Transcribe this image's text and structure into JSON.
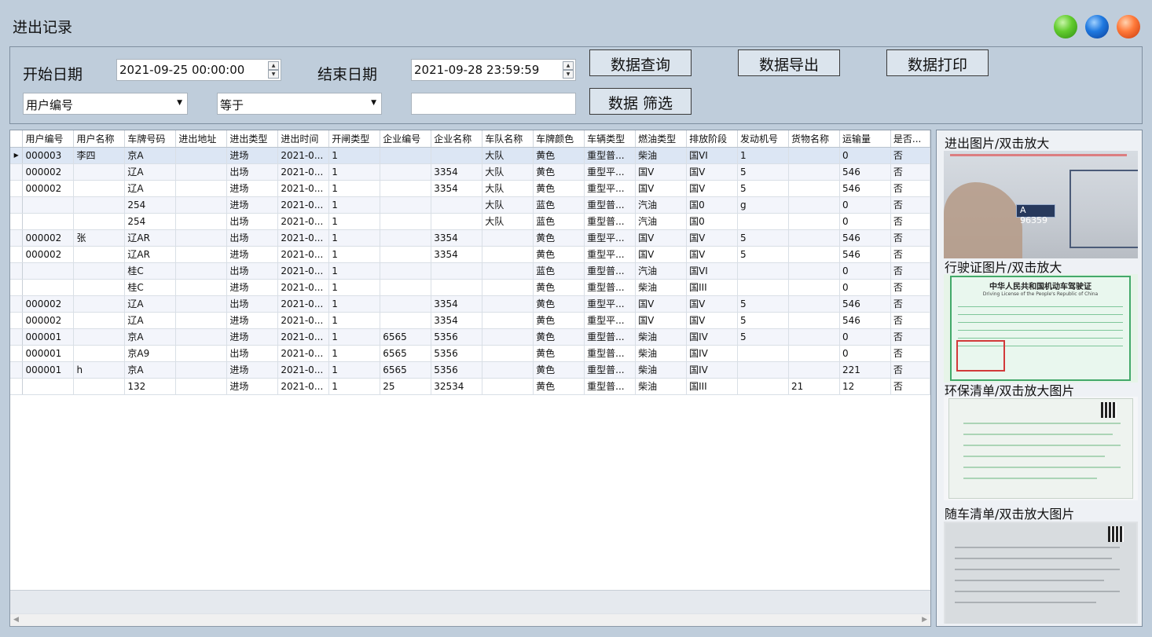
{
  "window": {
    "title": "进出记录",
    "controls": [
      "green-orb",
      "blue-orb",
      "orange-orb"
    ]
  },
  "filters": {
    "start_label": "开始日期",
    "start_value": "2021-09-25 00:00:00",
    "end_label": "结束日期",
    "end_value": "2021-09-28 23:59:59",
    "field_select": "用户编号",
    "operator_select": "等于",
    "filter_value": "",
    "buttons": {
      "query": "数据查询",
      "export": "数据导出",
      "print": "数据打印",
      "filter": "数据 筛选"
    }
  },
  "grid": {
    "columns": [
      "用户编号",
      "用户名称",
      "车牌号码",
      "进出地址",
      "进出类型",
      "进出时间",
      "开闸类型",
      "企业编号",
      "企业名称",
      "车队名称",
      "车牌颜色",
      "车辆类型",
      "燃油类型",
      "排放阶段",
      "发动机号",
      "货物名称",
      "运输量",
      "是否..."
    ],
    "rows": [
      [
        "000003",
        "李四",
        "京A",
        "",
        "进场",
        "2021-0...",
        "1",
        "",
        "",
        "大队",
        "黄色",
        "重型普...",
        "柴油",
        "国VI",
        "1",
        "",
        "0",
        "否"
      ],
      [
        "000002",
        "",
        "辽A",
        "",
        "出场",
        "2021-0...",
        "1",
        "",
        "3354",
        "大队",
        "黄色",
        "重型平...",
        "国V",
        "国V",
        "5",
        "",
        "546",
        "否"
      ],
      [
        "000002",
        "",
        "辽A",
        "",
        "进场",
        "2021-0...",
        "1",
        "",
        "3354",
        "大队",
        "黄色",
        "重型平...",
        "国V",
        "国V",
        "5",
        "",
        "546",
        "否"
      ],
      [
        "",
        "",
        "254",
        "",
        "进场",
        "2021-0...",
        "1",
        "",
        "",
        "大队",
        "蓝色",
        "重型普...",
        "汽油",
        "国0",
        "g",
        "",
        "0",
        "否"
      ],
      [
        "",
        "",
        "254",
        "",
        "出场",
        "2021-0...",
        "1",
        "",
        "",
        "大队",
        "蓝色",
        "重型普...",
        "汽油",
        "国0",
        "",
        "",
        "0",
        "否"
      ],
      [
        "000002",
        "张",
        "辽AR",
        "",
        "出场",
        "2021-0...",
        "1",
        "",
        "3354",
        "",
        "黄色",
        "重型平...",
        "国V",
        "国V",
        "5",
        "",
        "546",
        "否"
      ],
      [
        "000002",
        "",
        "辽AR",
        "",
        "进场",
        "2021-0...",
        "1",
        "",
        "3354",
        "",
        "黄色",
        "重型平...",
        "国V",
        "国V",
        "5",
        "",
        "546",
        "否"
      ],
      [
        "",
        "",
        "桂C",
        "",
        "出场",
        "2021-0...",
        "1",
        "",
        "",
        "",
        "蓝色",
        "重型普...",
        "汽油",
        "国VI",
        "",
        "",
        "0",
        "否"
      ],
      [
        "",
        "",
        "桂C",
        "",
        "进场",
        "2021-0...",
        "1",
        "",
        "",
        "",
        "黄色",
        "重型普...",
        "柴油",
        "国III",
        "",
        "",
        "0",
        "否"
      ],
      [
        "000002",
        "",
        "辽A",
        "",
        "出场",
        "2021-0...",
        "1",
        "",
        "3354",
        "",
        "黄色",
        "重型平...",
        "国V",
        "国V",
        "5",
        "",
        "546",
        "否"
      ],
      [
        "000002",
        "",
        "辽A",
        "",
        "进场",
        "2021-0...",
        "1",
        "",
        "3354",
        "",
        "黄色",
        "重型平...",
        "国V",
        "国V",
        "5",
        "",
        "546",
        "否"
      ],
      [
        "000001",
        "",
        "京A",
        "",
        "进场",
        "2021-0...",
        "1",
        "6565",
        "5356",
        "",
        "黄色",
        "重型普...",
        "柴油",
        "国IV",
        "5",
        "",
        "0",
        "否"
      ],
      [
        "000001",
        "",
        "京A9",
        "",
        "出场",
        "2021-0...",
        "1",
        "6565",
        "5356",
        "",
        "黄色",
        "重型普...",
        "柴油",
        "国IV",
        "",
        "",
        "0",
        "否"
      ],
      [
        "000001",
        "h",
        "京A",
        "",
        "进场",
        "2021-0...",
        "1",
        "6565",
        "5356",
        "",
        "黄色",
        "重型普...",
        "柴油",
        "国IV",
        "",
        "",
        "221",
        "否"
      ],
      [
        "",
        "",
        "132",
        "",
        "进场",
        "2021-0...",
        "1",
        "25",
        "32534",
        "",
        "黄色",
        "重型普...",
        "柴油",
        "国III",
        "",
        "21",
        "12",
        "否"
      ]
    ]
  },
  "side": {
    "entry_photo_title": "进出图片/双击放大",
    "plate_text": "A 96359",
    "license_title": "行驶证图片/双击放大",
    "license_heading": "中华人民共和国机动车驾驶证",
    "license_sub": "Driving License of the People's Republic of China",
    "env_title": "环保清单/双击放大图片",
    "cargo_title": "随车清单/双击放大图片"
  }
}
